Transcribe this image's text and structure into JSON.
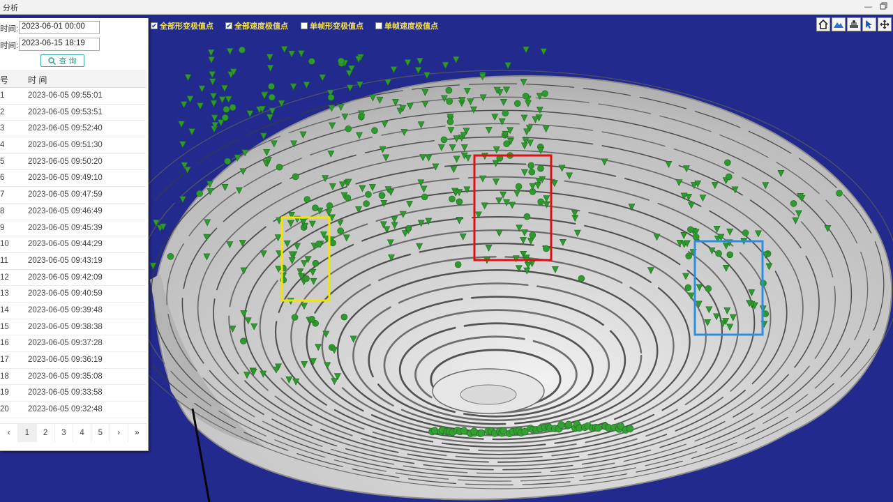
{
  "window": {
    "title": "分析"
  },
  "legend": [
    {
      "label": "全部形变极值点",
      "checked": true
    },
    {
      "label": "全部速度极值点",
      "checked": true
    },
    {
      "label": "单帧形变极值点",
      "checked": false
    },
    {
      "label": "单帧速度极值点",
      "checked": false
    }
  ],
  "toolbar": [
    {
      "icon": "home-icon"
    },
    {
      "icon": "terrain-icon"
    },
    {
      "icon": "layers-icon"
    },
    {
      "icon": "pointer-icon"
    },
    {
      "icon": "zoom-icon"
    }
  ],
  "query": {
    "start_label": "时间:",
    "start_value": "2023-06-01 00:00",
    "end_label": "时间:",
    "end_value": "2023-06-15 18:19",
    "button_label": "查 询"
  },
  "table": {
    "headers": [
      "号",
      "时 间"
    ],
    "rows": [
      {
        "num": "1",
        "time": "2023-06-05 09:55:01"
      },
      {
        "num": "2",
        "time": "2023-06-05 09:53:51"
      },
      {
        "num": "3",
        "time": "2023-06-05 09:52:40"
      },
      {
        "num": "4",
        "time": "2023-06-05 09:51:30"
      },
      {
        "num": "5",
        "time": "2023-06-05 09:50:20"
      },
      {
        "num": "6",
        "time": "2023-06-05 09:49:10"
      },
      {
        "num": "7",
        "time": "2023-06-05 09:47:59"
      },
      {
        "num": "8",
        "time": "2023-06-05 09:46:49"
      },
      {
        "num": "9",
        "time": "2023-06-05 09:45:39"
      },
      {
        "num": "10",
        "time": "2023-06-05 09:44:29"
      },
      {
        "num": "11",
        "time": "2023-06-05 09:43:19"
      },
      {
        "num": "12",
        "time": "2023-06-05 09:42:09"
      },
      {
        "num": "13",
        "time": "2023-06-05 09:40:59"
      },
      {
        "num": "14",
        "time": "2023-06-05 09:39:48"
      },
      {
        "num": "15",
        "time": "2023-06-05 09:38:38"
      },
      {
        "num": "16",
        "time": "2023-06-05 09:37:28"
      },
      {
        "num": "17",
        "time": "2023-06-05 09:36:19"
      },
      {
        "num": "18",
        "time": "2023-06-05 09:35:08"
      },
      {
        "num": "19",
        "time": "2023-06-05 09:33:58"
      },
      {
        "num": "20",
        "time": "2023-06-05 09:32:48"
      }
    ]
  },
  "pagination": {
    "prev": "‹",
    "pages": [
      "1",
      "2",
      "3",
      "4",
      "5"
    ],
    "next": "›",
    "last": "»",
    "current": "1"
  },
  "scene": {
    "background": "#232a8e",
    "terrain_color": "#c9c9c9",
    "marker_color": "#2e9a2e",
    "highlight_boxes": [
      {
        "name": "yellow-highlight-box",
        "color": "#f2e600"
      },
      {
        "name": "red-highlight-box",
        "color": "#e01010"
      },
      {
        "name": "blue-highlight-box",
        "color": "#2a8fe0"
      }
    ]
  }
}
